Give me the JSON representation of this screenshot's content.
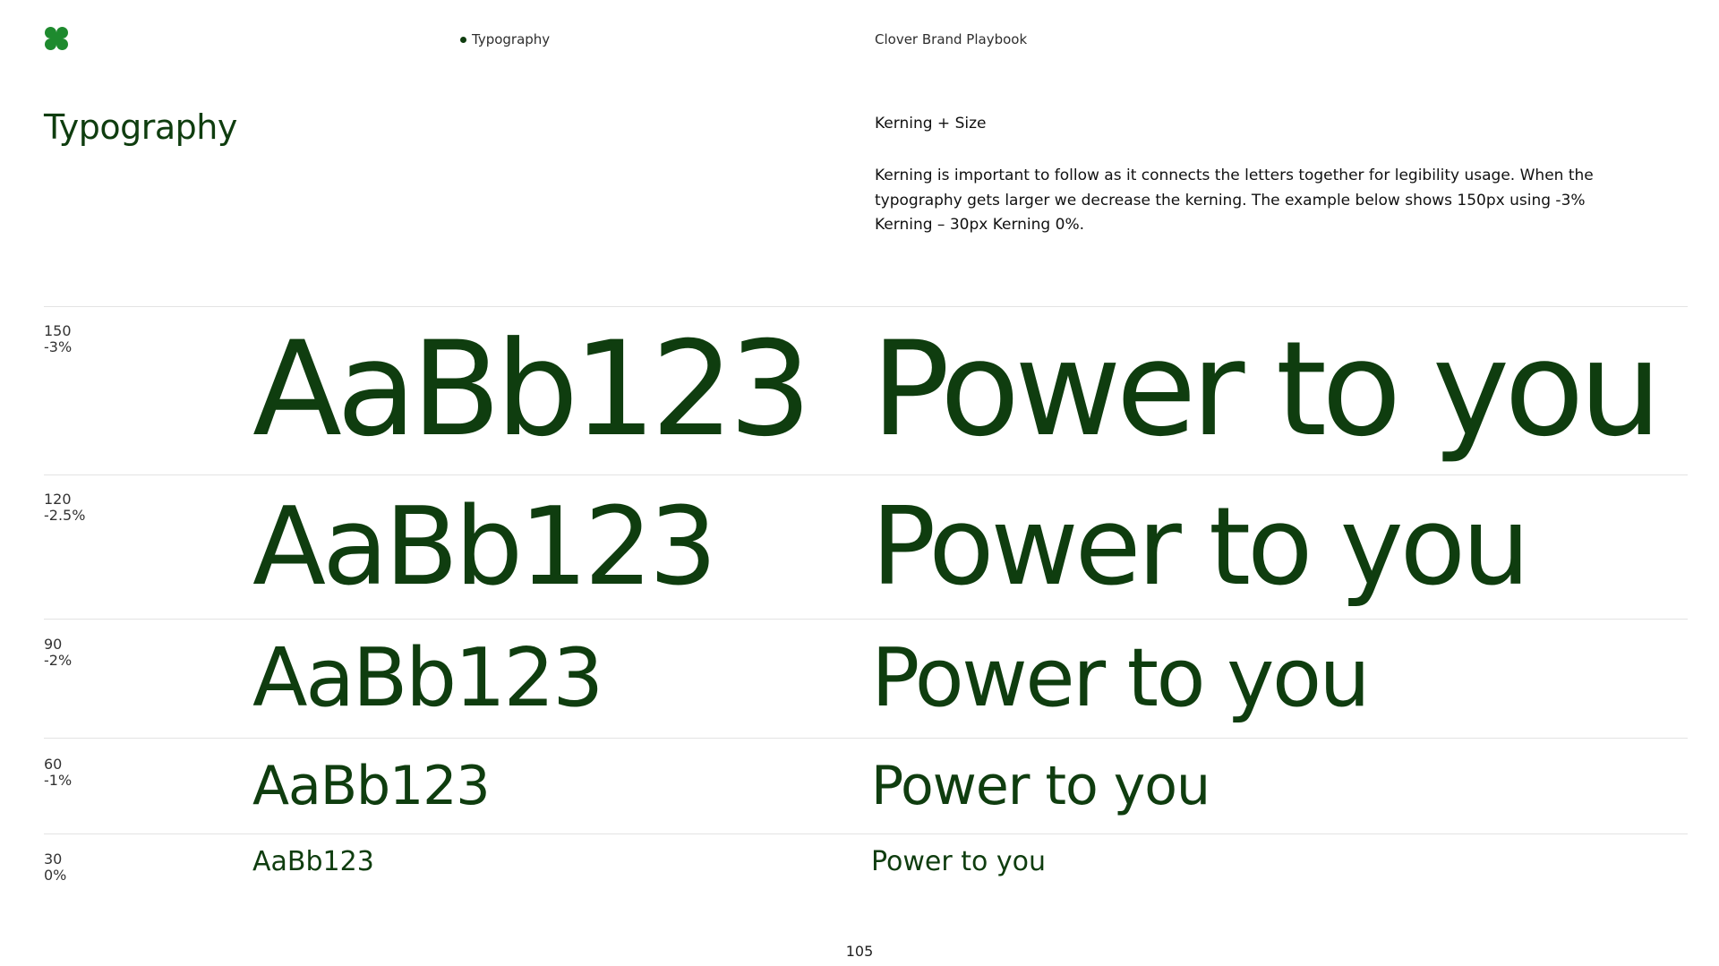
{
  "header": {
    "logo_icon": "clover-logo-icon",
    "section_tag": "Typography",
    "playbook_title": "Clover Brand Playbook"
  },
  "page_title": "Typography",
  "intro": {
    "heading": "Kerning + Size",
    "body": "Kerning is important to follow as it connects the letters together for legibility usage. When the typography gets larger we decrease the kerning. The example below shows 150px using -3% Kerning – 30px Kerning 0%."
  },
  "scale": {
    "rows": [
      {
        "size": "150",
        "kerning": "-3%",
        "sample": "AaBb123",
        "phrase": "Power to you"
      },
      {
        "size": "120",
        "kerning": "-2.5%",
        "sample": "AaBb123",
        "phrase": "Power to you"
      },
      {
        "size": "90",
        "kerning": "-2%",
        "sample": "AaBb123",
        "phrase": "Power to you"
      },
      {
        "size": "60",
        "kerning": "-1%",
        "sample": "AaBb123",
        "phrase": "Power to you"
      },
      {
        "size": "30",
        "kerning": "0%",
        "sample": "AaBb123",
        "phrase": "Power to you"
      }
    ]
  },
  "colors": {
    "brand_green": "#0f3d0f",
    "logo_green": "#1e8a2e",
    "divider": "#e3e3e3"
  },
  "footer": {
    "page_number": "105"
  }
}
